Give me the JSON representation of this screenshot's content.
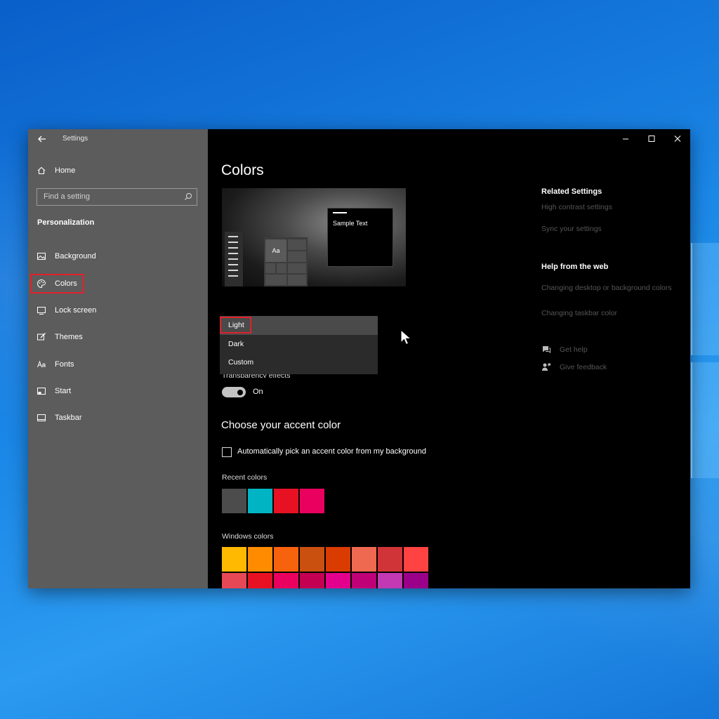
{
  "window": {
    "title": "Settings"
  },
  "sidebar": {
    "home_label": "Home",
    "search_placeholder": "Find a setting",
    "section": "Personalization",
    "items": [
      {
        "label": "Background",
        "icon": "image-icon"
      },
      {
        "label": "Colors",
        "icon": "palette-icon",
        "selected": true
      },
      {
        "label": "Lock screen",
        "icon": "lock-screen-icon"
      },
      {
        "label": "Themes",
        "icon": "brush-icon"
      },
      {
        "label": "Fonts",
        "icon": "fonts-icon"
      },
      {
        "label": "Start",
        "icon": "start-icon"
      },
      {
        "label": "Taskbar",
        "icon": "taskbar-icon"
      }
    ]
  },
  "main": {
    "title": "Colors",
    "preview": {
      "sample_text": "Sample Text",
      "tile_text": "Aa"
    },
    "mode_dropdown": {
      "options": [
        "Light",
        "Dark",
        "Custom"
      ],
      "highlighted": "Light"
    },
    "transparency": {
      "label": "Transparency effects",
      "state": "On"
    },
    "accent_title": "Choose your accent color",
    "auto_pick_label": "Automatically pick an accent color from my background",
    "recent_label": "Recent colors",
    "recent_colors": [
      "#4c4c4c",
      "#00b4c4",
      "#e81123",
      "#ea005e"
    ],
    "windows_label": "Windows colors",
    "windows_colors_row1": [
      "#ffb900",
      "#ff8c00",
      "#f7630c",
      "#ca5010",
      "#da3b01",
      "#ef6950",
      "#d13438",
      "#ff4343"
    ],
    "windows_colors_row2": [
      "#e74856",
      "#e81123",
      "#ea005e",
      "#c30052",
      "#e3008c",
      "#bf0077",
      "#c239b3",
      "#9a0089"
    ]
  },
  "related": {
    "title": "Related Settings",
    "links": [
      "High contrast settings",
      "Sync your settings"
    ]
  },
  "help": {
    "title": "Help from the web",
    "links": [
      "Changing desktop or background colors",
      "Changing taskbar color"
    ]
  },
  "actions": {
    "get_help": "Get help",
    "give_feedback": "Give feedback"
  }
}
